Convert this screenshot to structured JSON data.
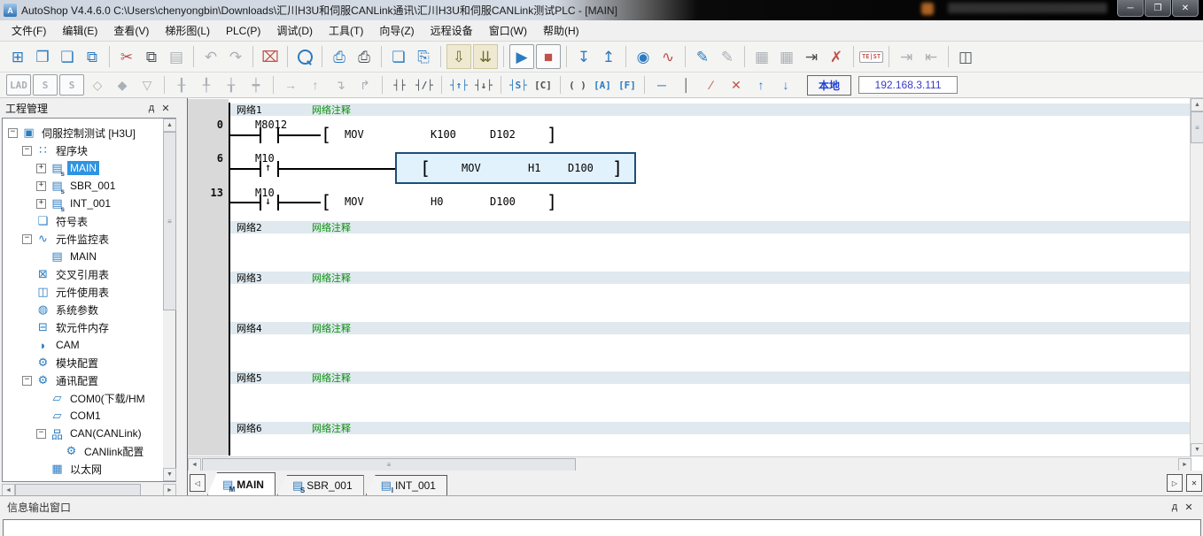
{
  "window": {
    "title": "AutoShop V4.4.6.0  C:\\Users\\chenyongbin\\Downloads\\汇川H3U和伺服CANLink通讯\\汇川H3U和伺服CANLink测试PLC - [MAIN]",
    "logo_text": "A",
    "minimize_glyph": "─",
    "restore_glyph": "❐",
    "close_glyph": "✕"
  },
  "menu_bar": [
    "文件(F)",
    "编辑(E)",
    "查看(V)",
    "梯形图(L)",
    "PLC(P)",
    "调试(D)",
    "工具(T)",
    "向导(Z)",
    "远程设备",
    "窗口(W)",
    "帮助(H)"
  ],
  "toolbar_main": [
    {
      "n": "new-file",
      "g": "⊞",
      "c": "b"
    },
    {
      "n": "open-project",
      "g": "❐",
      "c": "b"
    },
    {
      "n": "save",
      "g": "❏",
      "c": "b"
    },
    {
      "n": "save-all",
      "g": "⧉",
      "c": "b"
    },
    {
      "sep": true
    },
    {
      "n": "cut",
      "g": "✂",
      "c": "r"
    },
    {
      "n": "copy",
      "g": "⧉",
      "c": "d"
    },
    {
      "n": "paste",
      "g": "▤",
      "c": "g"
    },
    {
      "sep": true
    },
    {
      "n": "undo",
      "g": "↶",
      "c": "g"
    },
    {
      "n": "redo",
      "g": "↷",
      "c": "g"
    },
    {
      "sep": true
    },
    {
      "n": "delete",
      "g": "⌧",
      "c": "r"
    },
    {
      "sep": true
    },
    {
      "n": "search",
      "kind": "mag"
    },
    {
      "sep": true
    },
    {
      "n": "print-preview",
      "g": "⎙",
      "c": "b"
    },
    {
      "n": "print",
      "g": "⎙",
      "c": "d"
    },
    {
      "sep": true
    },
    {
      "n": "cascade-windows",
      "g": "❏",
      "c": "b"
    },
    {
      "n": "export-window",
      "g": "⎘",
      "c": "b"
    },
    {
      "sep": true
    },
    {
      "n": "compile",
      "g": "⇩",
      "c": "o",
      "beige": true
    },
    {
      "n": "compile-all",
      "g": "⇊",
      "c": "o",
      "beige": true
    },
    {
      "sep": true
    },
    {
      "n": "run",
      "g": "▶",
      "c": "b",
      "frame": true
    },
    {
      "n": "stop",
      "g": "■",
      "c": "r",
      "frame": true
    },
    {
      "sep": true
    },
    {
      "n": "download",
      "g": "↧",
      "c": "b"
    },
    {
      "n": "upload",
      "g": "↥",
      "c": "b"
    },
    {
      "sep": true
    },
    {
      "n": "monitor",
      "g": "◉",
      "c": "b"
    },
    {
      "n": "oscilloscope",
      "g": "∿",
      "c": "r"
    },
    {
      "sep": true
    },
    {
      "n": "write-edit",
      "g": "✎",
      "c": "b"
    },
    {
      "n": "read-edit",
      "g": "✎",
      "c": "g"
    },
    {
      "sep": true
    },
    {
      "n": "convert-grid",
      "g": "▦",
      "c": "g"
    },
    {
      "n": "convert-grid-delete",
      "g": "▦",
      "c": "g"
    },
    {
      "n": "insert-network",
      "g": "⇥",
      "c": "d"
    },
    {
      "n": "delete-network",
      "g": "✗",
      "c": "r"
    },
    {
      "sep": true
    },
    {
      "n": "test",
      "kind": "test",
      "t": "TE|ST"
    },
    {
      "sep": true
    },
    {
      "n": "step-into",
      "g": "⇥",
      "c": "g"
    },
    {
      "n": "step-out",
      "g": "⇤",
      "c": "g"
    },
    {
      "sep": true
    },
    {
      "n": "memory-view",
      "g": "◫",
      "c": "d"
    }
  ],
  "toolbar_ladder": {
    "items": [
      {
        "n": "lad-mode",
        "kind": "txt",
        "t": "LAD",
        "c": "g",
        "frame": true
      },
      {
        "n": "stl-block",
        "kind": "txt",
        "t": "S",
        "c": "g",
        "frame": true
      },
      {
        "n": "stl-step",
        "kind": "txt",
        "t": "S",
        "c": "g",
        "frame": true
      },
      {
        "n": "branch-open",
        "g": "◇",
        "c": "g"
      },
      {
        "n": "branch-down",
        "g": "◆",
        "c": "g"
      },
      {
        "n": "branch-down-open",
        "g": "▽",
        "c": "g"
      },
      {
        "sep": true
      },
      {
        "n": "edit-cell-1",
        "g": "╂",
        "c": "g"
      },
      {
        "n": "edit-cell-2",
        "g": "╀",
        "c": "g"
      },
      {
        "n": "edit-cell-3",
        "g": "╁",
        "c": "g"
      },
      {
        "n": "edit-cell-4",
        "g": "┿",
        "c": "g"
      },
      {
        "sep": true
      },
      {
        "n": "arrow-right",
        "g": "→",
        "c": "g"
      },
      {
        "n": "arrow-up",
        "g": "↑",
        "c": "g"
      },
      {
        "n": "corner-down",
        "g": "↴",
        "c": "g"
      },
      {
        "n": "corner-up",
        "g": "↱",
        "c": "g"
      },
      {
        "sep": true
      },
      {
        "n": "no-contact",
        "kind": "txt",
        "t": "┤├",
        "c": "d"
      },
      {
        "n": "nc-contact",
        "kind": "txt",
        "t": "┤/├",
        "c": "d"
      },
      {
        "sep": true
      },
      {
        "n": "rising-contact",
        "kind": "txt",
        "t": "┤↑├",
        "c": "b"
      },
      {
        "n": "falling-contact",
        "kind": "txt",
        "t": "┤↓├",
        "c": "d"
      },
      {
        "sep": true
      },
      {
        "n": "set-coil",
        "kind": "txt",
        "t": "┤S├",
        "c": "b"
      },
      {
        "n": "counter-coil",
        "kind": "txt",
        "t": "[C]",
        "c": "d"
      },
      {
        "sep": true
      },
      {
        "n": "out-coil",
        "kind": "txt",
        "t": "( )",
        "c": "d"
      },
      {
        "n": "app-instruction",
        "kind": "txt",
        "t": "[A]",
        "c": "b"
      },
      {
        "n": "func-instruction",
        "kind": "txt",
        "t": "[F]",
        "c": "b"
      },
      {
        "sep": true
      },
      {
        "n": "h-line",
        "g": "─",
        "c": "b"
      },
      {
        "n": "v-line",
        "g": "│",
        "c": "d"
      },
      {
        "n": "delete-line",
        "g": "∕",
        "c": "r"
      },
      {
        "n": "delete-cross",
        "g": "✕",
        "c": "r"
      },
      {
        "n": "line-up",
        "g": "↑",
        "c": "b"
      },
      {
        "n": "line-down",
        "g": "↓",
        "c": "b"
      }
    ],
    "local_button": "本地",
    "ip_address": "192.168.3.111"
  },
  "project_panel": {
    "title": "工程管理",
    "pin_glyph": "д",
    "close_glyph": "✕",
    "tree": [
      {
        "label": "伺服控制测试 [H3U]",
        "icon": "▣",
        "iname": "plc-project-icon",
        "lvl": 0,
        "exp": "-"
      },
      {
        "label": "程序块",
        "icon": "∷",
        "iname": "program-blocks-icon",
        "lvl": 1,
        "exp": "-"
      },
      {
        "label": "MAIN",
        "icon": "▤",
        "sub": "s",
        "iname": "program-icon",
        "lvl": 2,
        "exp": "+",
        "sel": true
      },
      {
        "label": "SBR_001",
        "icon": "▤",
        "sub": "s",
        "iname": "program-icon",
        "lvl": 2,
        "exp": "+"
      },
      {
        "label": "INT_001",
        "icon": "▤",
        "sub": "s",
        "iname": "program-icon",
        "lvl": 2,
        "exp": "+"
      },
      {
        "label": "符号表",
        "icon": "❑",
        "iname": "symbol-table-icon",
        "lvl": 1,
        "exp": ""
      },
      {
        "label": "元件监控表",
        "icon": "∿",
        "iname": "watch-table-icon",
        "lvl": 1,
        "exp": "-"
      },
      {
        "label": "MAIN",
        "icon": "▤",
        "iname": "watch-doc-icon",
        "lvl": 2,
        "exp": ""
      },
      {
        "label": "交叉引用表",
        "icon": "⊠",
        "iname": "cross-reference-icon",
        "lvl": 1,
        "exp": ""
      },
      {
        "label": "元件使用表",
        "icon": "◫",
        "iname": "usage-table-icon",
        "lvl": 1,
        "exp": ""
      },
      {
        "label": "系统参数",
        "icon": "◍",
        "iname": "system-params-icon",
        "lvl": 1,
        "exp": ""
      },
      {
        "label": "软元件内存",
        "icon": "⊟",
        "iname": "device-memory-icon",
        "lvl": 1,
        "exp": ""
      },
      {
        "label": "CAM",
        "icon": "◗",
        "iname": "cam-icon",
        "lvl": 1,
        "exp": ""
      },
      {
        "label": "模块配置",
        "icon": "⚙",
        "iname": "module-config-icon",
        "lvl": 1,
        "exp": ""
      },
      {
        "label": "通讯配置",
        "icon": "⚙",
        "iname": "comm-config-icon",
        "lvl": 1,
        "exp": "-"
      },
      {
        "label": "COM0(下载/HM",
        "icon": "▱",
        "iname": "com-port-icon",
        "lvl": 2,
        "exp": ""
      },
      {
        "label": "COM1",
        "icon": "▱",
        "iname": "com-port-icon",
        "lvl": 2,
        "exp": ""
      },
      {
        "label": "CAN(CANLink)",
        "icon": "品",
        "iname": "can-network-icon",
        "lvl": 2,
        "exp": "-"
      },
      {
        "label": "CANlink配置",
        "icon": "⚙",
        "iname": "canlink-config-icon",
        "lvl": 3,
        "exp": ""
      },
      {
        "label": "以太网",
        "icon": "▦",
        "iname": "ethernet-icon",
        "lvl": 2,
        "exp": ""
      },
      {
        "label": "",
        "icon": "▣",
        "iname": "clipped-item-icon",
        "lvl": 0,
        "exp": ""
      }
    ]
  },
  "editor": {
    "networks": [
      {
        "label": "网络1",
        "comment": "网络注释"
      },
      {
        "label": "网络2",
        "comment": "网络注释"
      },
      {
        "label": "网络3",
        "comment": "网络注释"
      },
      {
        "label": "网络4",
        "comment": "网络注释"
      },
      {
        "label": "网络5",
        "comment": "网络注释"
      },
      {
        "label": "网络6",
        "comment": "网络注释"
      }
    ],
    "rungs": [
      {
        "step": "0",
        "contact": {
          "name": "M8012",
          "type": "no"
        },
        "instruction": {
          "op": "MOV",
          "src": "K100",
          "dst": "D102"
        },
        "selected": false
      },
      {
        "step": "6",
        "contact": {
          "name": "M10",
          "type": "rising"
        },
        "instruction": {
          "op": "MOV",
          "src": "H1",
          "dst": "D100"
        },
        "selected": true
      },
      {
        "step": "13",
        "contact": {
          "name": "M10",
          "type": "falling"
        },
        "instruction": {
          "op": "MOV",
          "src": "H0",
          "dst": "D100"
        },
        "selected": false
      }
    ]
  },
  "editor_tabs": [
    {
      "label": "MAIN",
      "sub": "M",
      "active": true
    },
    {
      "label": "SBR_001",
      "sub": "S",
      "active": false
    },
    {
      "label": "INT_001",
      "sub": "I",
      "active": false
    }
  ],
  "output_panel": {
    "title": "信息输出窗口",
    "pin_glyph": "д",
    "close_glyph": "✕"
  }
}
